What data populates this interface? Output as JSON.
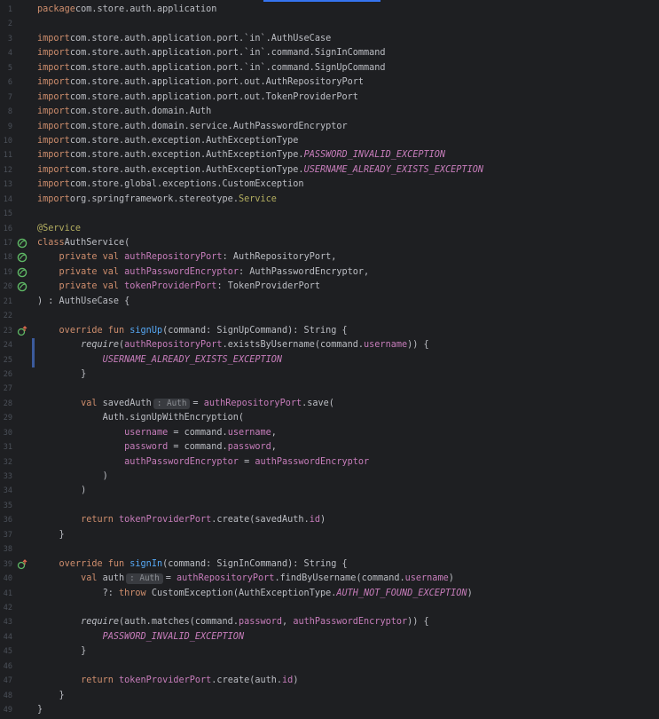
{
  "editor": {
    "lines": [
      {
        "n": "1",
        "segs": [
          [
            "kw",
            "package"
          ],
          [
            "",
            "com.store.auth.application"
          ]
        ]
      },
      {
        "n": "2",
        "segs": []
      },
      {
        "n": "3",
        "segs": [
          [
            "kw",
            "import"
          ],
          [
            "",
            "com.store.auth.application.port.`in`.AuthUseCase"
          ]
        ]
      },
      {
        "n": "4",
        "segs": [
          [
            "kw",
            "import"
          ],
          [
            "",
            "com.store.auth.application.port.`in`.command.SignInCommand"
          ]
        ]
      },
      {
        "n": "5",
        "segs": [
          [
            "kw",
            "import"
          ],
          [
            "",
            "com.store.auth.application.port.`in`.command.SignUpCommand"
          ]
        ]
      },
      {
        "n": "6",
        "segs": [
          [
            "kw",
            "import"
          ],
          [
            "",
            "com.store.auth.application.port.out.AuthRepositoryPort"
          ]
        ]
      },
      {
        "n": "7",
        "segs": [
          [
            "kw",
            "import"
          ],
          [
            "",
            "com.store.auth.application.port.out.TokenProviderPort"
          ]
        ]
      },
      {
        "n": "8",
        "segs": [
          [
            "kw",
            "import"
          ],
          [
            "",
            "com.store.auth.domain.Auth"
          ]
        ]
      },
      {
        "n": "9",
        "segs": [
          [
            "kw",
            "import"
          ],
          [
            "",
            "com.store.auth.domain.service.AuthPasswordEncryptor"
          ]
        ]
      },
      {
        "n": "10",
        "segs": [
          [
            "kw",
            "import"
          ],
          [
            "",
            "com.store.auth.exception.AuthExceptionType"
          ]
        ]
      },
      {
        "n": "11",
        "segs": [
          [
            "kw",
            "import"
          ],
          [
            "",
            "com.store.auth.exception.AuthExceptionType."
          ],
          [
            "cst",
            "PASSWORD_INVALID_EXCEPTION"
          ]
        ]
      },
      {
        "n": "12",
        "segs": [
          [
            "kw",
            "import"
          ],
          [
            "",
            "com.store.auth.exception.AuthExceptionType."
          ],
          [
            "cst",
            "USERNAME_ALREADY_EXISTS_EXCEPTION"
          ]
        ]
      },
      {
        "n": "13",
        "segs": [
          [
            "kw",
            "import"
          ],
          [
            "",
            "com.store.global.exceptions.CustomException"
          ]
        ]
      },
      {
        "n": "14",
        "segs": [
          [
            "kw",
            "import"
          ],
          [
            "",
            "org.springframework.stereotype."
          ],
          [
            "ann",
            "Service"
          ]
        ]
      },
      {
        "n": "15",
        "segs": []
      },
      {
        "n": "16",
        "segs": [
          [
            "ann",
            "@Service"
          ]
        ]
      },
      {
        "n": "17",
        "icon": "spring-bean-icon",
        "segs": [
          [
            "kw",
            "class"
          ],
          [
            "",
            "AuthService("
          ]
        ]
      },
      {
        "n": "18",
        "icon": "spring-bean-icon",
        "segs": [
          [
            "",
            "    "
          ],
          [
            "kw",
            "private val"
          ],
          [
            "",
            ""
          ],
          [
            "prop",
            "authRepositoryPort"
          ],
          [
            "",
            ": AuthRepositoryPort,"
          ]
        ]
      },
      {
        "n": "19",
        "icon": "spring-bean-icon",
        "segs": [
          [
            "",
            "    "
          ],
          [
            "kw",
            "private val"
          ],
          [
            "",
            ""
          ],
          [
            "prop",
            "authPasswordEncryptor"
          ],
          [
            "",
            ": AuthPasswordEncryptor,"
          ]
        ]
      },
      {
        "n": "20",
        "icon": "spring-bean-icon",
        "segs": [
          [
            "",
            "    "
          ],
          [
            "kw",
            "private val"
          ],
          [
            "",
            ""
          ],
          [
            "prop",
            "tokenProviderPort"
          ],
          [
            "",
            ": TokenProviderPort"
          ]
        ]
      },
      {
        "n": "21",
        "segs": [
          [
            "",
            ") : AuthUseCase {"
          ]
        ]
      },
      {
        "n": "22",
        "segs": []
      },
      {
        "n": "23",
        "icon": "override-icon",
        "segs": [
          [
            "",
            "    "
          ],
          [
            "kw",
            "override fun"
          ],
          [
            "",
            ""
          ],
          [
            "fn",
            "signUp"
          ],
          [
            "",
            "(command: SignUpCommand): String {"
          ]
        ]
      },
      {
        "n": "24",
        "changed": true,
        "segs": [
          [
            "",
            "        "
          ],
          [
            "itl",
            "require"
          ],
          [
            "",
            "("
          ],
          [
            "prop",
            "authRepositoryPort"
          ],
          [
            "",
            ".existsByUsername(command."
          ],
          [
            "prop",
            "username"
          ],
          [
            "",
            ")) {"
          ]
        ]
      },
      {
        "n": "25",
        "changed": true,
        "segs": [
          [
            "",
            "            "
          ],
          [
            "cst",
            "USERNAME_ALREADY_EXISTS_EXCEPTION"
          ]
        ]
      },
      {
        "n": "26",
        "segs": [
          [
            "",
            "        }"
          ]
        ]
      },
      {
        "n": "27",
        "segs": []
      },
      {
        "n": "28",
        "hint": ": Auth",
        "segs": [
          [
            "",
            "        "
          ],
          [
            "kw",
            "val"
          ],
          [
            "",
            " savedAuth"
          ],
          [
            "hint",
            ""
          ],
          [
            "",
            "= "
          ],
          [
            "prop",
            "authRepositoryPort"
          ],
          [
            "",
            ".save("
          ]
        ]
      },
      {
        "n": "29",
        "segs": [
          [
            "",
            "            Auth.signUpWithEncryption("
          ]
        ]
      },
      {
        "n": "30",
        "segs": [
          [
            "",
            "                "
          ],
          [
            "prop",
            "username"
          ],
          [
            "",
            " = command."
          ],
          [
            "prop",
            "username"
          ],
          [
            "",
            ","
          ]
        ]
      },
      {
        "n": "31",
        "segs": [
          [
            "",
            "                "
          ],
          [
            "prop",
            "password"
          ],
          [
            "",
            " = command."
          ],
          [
            "prop",
            "password"
          ],
          [
            "",
            ","
          ]
        ]
      },
      {
        "n": "32",
        "segs": [
          [
            "",
            "                "
          ],
          [
            "prop",
            "authPasswordEncryptor"
          ],
          [
            "",
            " = "
          ],
          [
            "prop",
            "authPasswordEncryptor"
          ]
        ]
      },
      {
        "n": "33",
        "segs": [
          [
            "",
            "            )"
          ]
        ]
      },
      {
        "n": "34",
        "segs": [
          [
            "",
            "        )"
          ]
        ]
      },
      {
        "n": "35",
        "segs": []
      },
      {
        "n": "36",
        "segs": [
          [
            "",
            "        "
          ],
          [
            "kw",
            "return"
          ],
          [
            "",
            ""
          ],
          [
            "prop",
            "tokenProviderPort"
          ],
          [
            "",
            ".create(savedAuth."
          ],
          [
            "prop",
            "id"
          ],
          [
            "",
            ")"
          ]
        ]
      },
      {
        "n": "37",
        "segs": [
          [
            "",
            "    }"
          ]
        ]
      },
      {
        "n": "38",
        "segs": []
      },
      {
        "n": "39",
        "icon": "override-icon",
        "segs": [
          [
            "",
            "    "
          ],
          [
            "kw",
            "override fun"
          ],
          [
            "",
            ""
          ],
          [
            "fn",
            "signIn"
          ],
          [
            "",
            "(command: SignInCommand): String {"
          ]
        ]
      },
      {
        "n": "40",
        "hint": ": Auth",
        "segs": [
          [
            "",
            "        "
          ],
          [
            "kw",
            "val"
          ],
          [
            "",
            " auth"
          ],
          [
            "hint",
            ""
          ],
          [
            "",
            "= "
          ],
          [
            "prop",
            "authRepositoryPort"
          ],
          [
            "",
            ".findByUsername(command."
          ],
          [
            "prop",
            "username"
          ],
          [
            "",
            ")"
          ]
        ]
      },
      {
        "n": "41",
        "segs": [
          [
            "",
            "            ?: "
          ],
          [
            "kw",
            "throw"
          ],
          [
            "",
            " CustomException(AuthExceptionType."
          ],
          [
            "cst",
            "AUTH_NOT_FOUND_EXCEPTION"
          ],
          [
            "",
            ")"
          ]
        ]
      },
      {
        "n": "42",
        "segs": []
      },
      {
        "n": "43",
        "segs": [
          [
            "",
            "        "
          ],
          [
            "itl",
            "require"
          ],
          [
            "",
            "(auth.matches(command."
          ],
          [
            "prop",
            "password"
          ],
          [
            "",
            ", "
          ],
          [
            "prop",
            "authPasswordEncryptor"
          ],
          [
            "",
            ")) {"
          ]
        ]
      },
      {
        "n": "44",
        "segs": [
          [
            "",
            "            "
          ],
          [
            "cst",
            "PASSWORD_INVALID_EXCEPTION"
          ]
        ]
      },
      {
        "n": "45",
        "segs": [
          [
            "",
            "        }"
          ]
        ]
      },
      {
        "n": "46",
        "segs": []
      },
      {
        "n": "47",
        "segs": [
          [
            "",
            "        "
          ],
          [
            "kw",
            "return"
          ],
          [
            "",
            ""
          ],
          [
            "prop",
            "tokenProviderPort"
          ],
          [
            "",
            ".create(auth."
          ],
          [
            "prop",
            "id"
          ],
          [
            "",
            ")"
          ]
        ]
      },
      {
        "n": "48",
        "segs": [
          [
            "",
            "    }"
          ]
        ]
      },
      {
        "n": "49",
        "segs": [
          [
            "",
            "}"
          ]
        ]
      }
    ]
  },
  "colors": {
    "background": "#1e1f22",
    "text": "#bcbec4",
    "keyword": "#cf8e6d",
    "annotation": "#b3ae60",
    "function": "#56a8f5",
    "property": "#c77dbb",
    "line_number": "#4b5059",
    "hint_bg": "#393b40",
    "accent": "#3574f0"
  }
}
